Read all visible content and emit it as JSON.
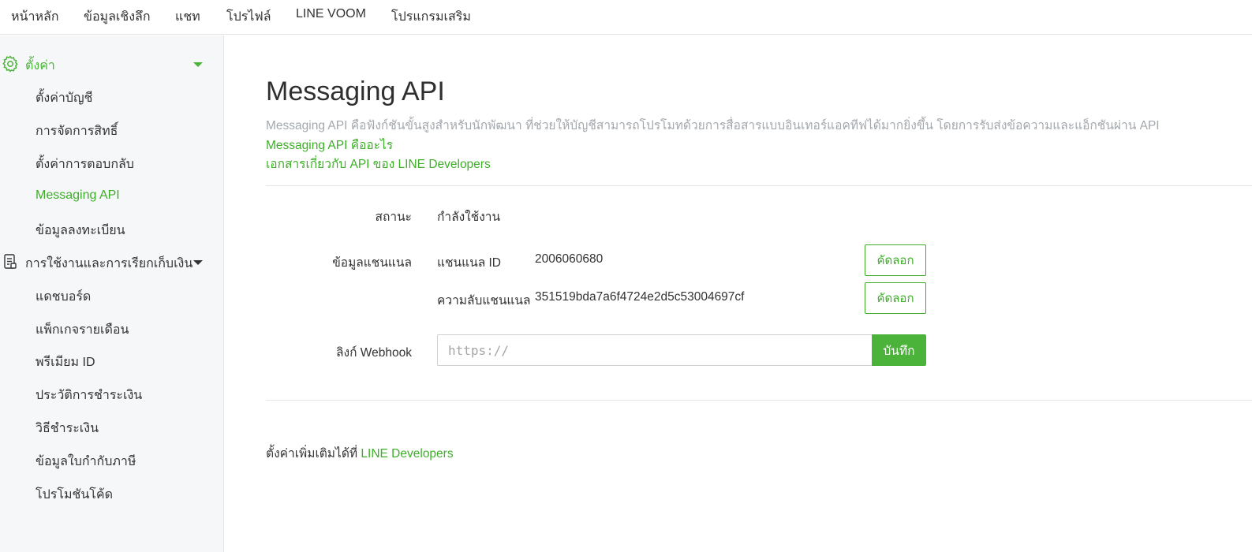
{
  "topnav": {
    "items": [
      "หน้าหลัก",
      "ข้อมูลเชิงลึก",
      "แชท",
      "โปรไฟล์",
      "LINE VOOM",
      "โปรแกรมเสริม"
    ]
  },
  "sidebar": {
    "settings_group": {
      "label": "ตั้งค่า",
      "icon": "gear-icon",
      "items": [
        "ตั้งค่าบัญชี",
        "การจัดการสิทธิ์",
        "ตั้งค่าการตอบกลับ",
        "Messaging API",
        "ข้อมูลลงทะเบียน"
      ],
      "active_item": "Messaging API"
    },
    "billing_group": {
      "label": "การใช้งานและการเรียกเก็บเงิน",
      "icon": "document-icon",
      "items": [
        "แดชบอร์ด",
        "แพ็กเกจรายเดือน",
        "พรีเมียม ID",
        "ประวัติการชำระเงิน",
        "วิธีชำระเงิน",
        "ข้อมูลใบกำกับภาษี",
        "โปรโมชันโค้ด"
      ]
    }
  },
  "main": {
    "title": "Messaging API",
    "description": "Messaging API คือฟังก์ชันขั้นสูงสำหรับนักพัฒนา ที่ช่วยให้บัญชีสามารถโปรโมทด้วยการสื่อสารแบบอินเทอร์แอคทีฟได้มากยิ่งขึ้น โดยการรับส่งข้อความและแอ็กชันผ่าน API",
    "link_what_is": "Messaging API คืออะไร",
    "link_docs": "เอกสารเกี่ยวกับ API ของ LINE Developers",
    "status": {
      "label": "สถานะ",
      "value": "กำลังใช้งาน"
    },
    "channel_info": {
      "label": "ข้อมูลแชนแนล",
      "channel_id_label": "แชนแนล ID",
      "channel_id_value": "2006060680",
      "channel_secret_label": "ความลับแชนแนล",
      "channel_secret_value": "351519bda7a6f4724e2d5c53004697cf",
      "copy_label": "คัดลอก"
    },
    "webhook": {
      "label": "ลิงก์ Webhook",
      "placeholder": "https://",
      "value": "",
      "save_label": "บันทึก"
    },
    "footer": {
      "text": "ตั้งค่าเพิ่มเติมได้ที่",
      "link": "LINE Developers"
    }
  },
  "colors": {
    "accent": "#3fae2a",
    "accent_button": "#4cb33a",
    "sidebar_bg": "#f6f7f9",
    "muted_text": "#a3a8ad"
  }
}
